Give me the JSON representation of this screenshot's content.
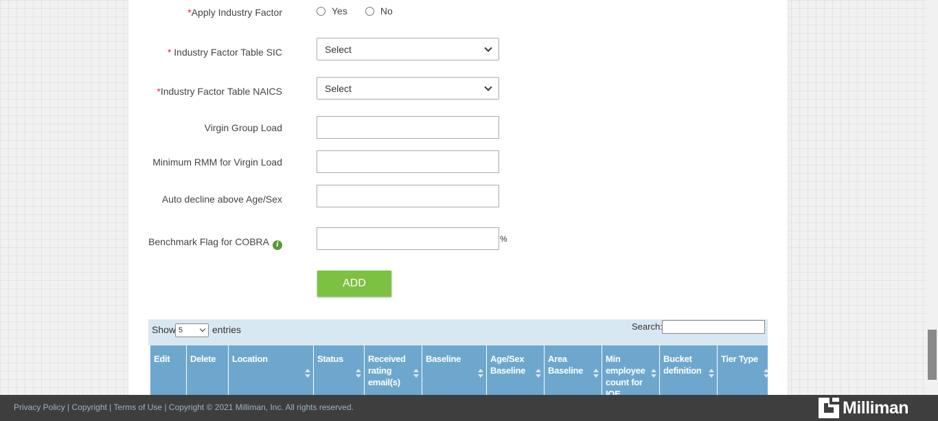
{
  "form": {
    "apply_industry_factor": {
      "required": "*",
      "label": "Apply Industry Factor",
      "options": [
        "Yes",
        "No"
      ]
    },
    "industry_factor_sic": {
      "required": "* ",
      "label": "Industry Factor Table SIC",
      "value": "Select"
    },
    "industry_factor_naics": {
      "required": "*",
      "label": "Industry Factor Table NAICS",
      "value": "Select"
    },
    "virgin_group_load": {
      "label": "Virgin Group Load",
      "value": ""
    },
    "minimum_rmm": {
      "label": "Minimum RMM for Virgin Load",
      "value": ""
    },
    "auto_decline": {
      "label": "Auto decline above Age/Sex",
      "value": ""
    },
    "benchmark_flag": {
      "label": "Benchmark Flag for COBRA",
      "info_icon": "i",
      "value": "",
      "unit": "%"
    },
    "add_button": "ADD"
  },
  "table": {
    "show_label": "Show",
    "entries_value": "5",
    "entries_label": "entries",
    "search_label": "Search:",
    "columns": [
      {
        "label": "Edit",
        "sortable": false
      },
      {
        "label": "Delete",
        "sortable": false
      },
      {
        "label": "Location",
        "sortable": true
      },
      {
        "label": "Status",
        "sortable": true
      },
      {
        "label": "Received rating email(s)",
        "sortable": true
      },
      {
        "label": "Baseline",
        "sortable": true
      },
      {
        "label": "Age/Sex Baseline",
        "sortable": true
      },
      {
        "label": "Area Baseline",
        "sortable": true
      },
      {
        "label": "Min employee count for IOE",
        "sortable": true
      },
      {
        "label": "Bucket definition",
        "sortable": true
      },
      {
        "label": "Tier Type",
        "sortable": true
      }
    ]
  },
  "footer": {
    "privacy": "Privacy Policy",
    "copyright_link": "Copyright",
    "terms": "Terms of Use",
    "sep": " | ",
    "copyright_text": "Copyright © 2021 Milliman, Inc. All rights reserved.",
    "logo_text": "Milliman"
  },
  "colors": {
    "accent_green": "#7cc142",
    "table_header": "#6ea7cd",
    "required_red": "#d9262b",
    "footer_bg": "#3e3e3e"
  }
}
